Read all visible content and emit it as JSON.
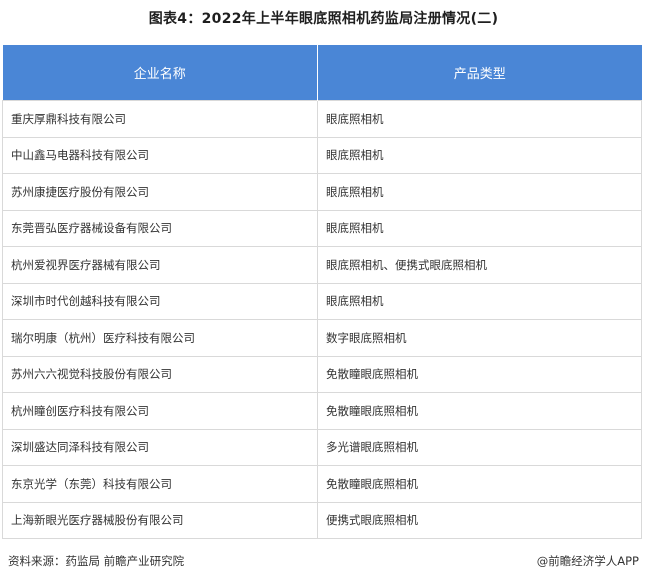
{
  "title": "图表4：2022年上半年眼底照相机药监局注册情况(二)",
  "table": {
    "headers": [
      "企业名称",
      "产品类型"
    ],
    "rows": [
      [
        "重庆厚鼎科技有限公司",
        "眼底照相机"
      ],
      [
        "中山鑫马电器科技有限公司",
        "眼底照相机"
      ],
      [
        "苏州康捷医疗股份有限公司",
        "眼底照相机"
      ],
      [
        "东莞晋弘医疗器械设备有限公司",
        "眼底照相机"
      ],
      [
        "杭州爱视界医疗器械有限公司",
        "眼底照相机、便携式眼底照相机"
      ],
      [
        "深圳市时代创越科技有限公司",
        "眼底照相机"
      ],
      [
        "瑞尔明康（杭州）医疗科技有限公司",
        "数字眼底照相机"
      ],
      [
        "苏州六六视觉科技股份有限公司",
        "免散瞳眼底照相机"
      ],
      [
        "杭州瞳创医疗科技有限公司",
        "免散瞳眼底照相机"
      ],
      [
        "深圳盛达同泽科技有限公司",
        "多光谱眼底照相机"
      ],
      [
        "东京光学（东莞）科技有限公司",
        "免散瞳眼底照相机"
      ],
      [
        "上海新眼光医疗器械股份有限公司",
        "便携式眼底照相机"
      ]
    ]
  },
  "footer": {
    "source": "资料来源：药监局 前瞻产业研究院",
    "brand": "@前瞻经济学人APP"
  }
}
